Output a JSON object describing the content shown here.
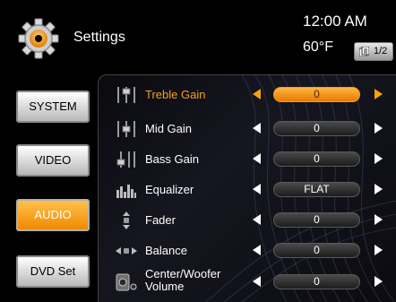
{
  "header": {
    "title": "Settings",
    "time": "12:00 AM",
    "temperature": "60°F",
    "page_indicator": "1/2",
    "icons": {
      "app": "gear-icon",
      "page": "pages-icon"
    }
  },
  "nav": [
    {
      "label": "SYSTEM",
      "active": false
    },
    {
      "label": "VIDEO",
      "active": false
    },
    {
      "label": "AUDIO",
      "active": true
    },
    {
      "label": "DVD Set",
      "active": false
    }
  ],
  "settings": [
    {
      "label": "Treble Gain",
      "value": "0",
      "selected": true,
      "icon": "treble-gain-icon"
    },
    {
      "label": "Mid Gain",
      "value": "0",
      "selected": false,
      "icon": "mid-gain-icon"
    },
    {
      "label": "Bass Gain",
      "value": "0",
      "selected": false,
      "icon": "bass-gain-icon"
    },
    {
      "label": "Equalizer",
      "value": "FLAT",
      "selected": false,
      "icon": "equalizer-icon"
    },
    {
      "label": "Fader",
      "value": "0",
      "selected": false,
      "icon": "fader-icon"
    },
    {
      "label": "Balance",
      "value": "0",
      "selected": false,
      "icon": "balance-icon"
    },
    {
      "label": "Center/Woofer Volume",
      "label_lines": [
        "Center/Woofer",
        "Volume"
      ],
      "value": "0",
      "selected": false,
      "icon": "speaker-icon"
    }
  ],
  "colors": {
    "accent": "#f6a10d",
    "active_button": "#f39a1a",
    "background": "#000000"
  }
}
